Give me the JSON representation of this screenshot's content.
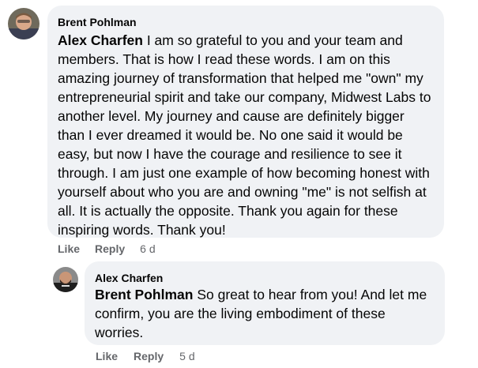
{
  "comments": [
    {
      "author": "Brent Pohlman",
      "mention": "Alex Charfen",
      "body": " I am so grateful to you and your team and members. That is how I read these words. I am on this amazing journey of transformation that helped me \"own\" my entrepreneurial spirit and take our company, Midwest Labs to another level. My journey and cause are definitely bigger than I ever dreamed it would be. No one said it would be easy, but now I have the courage and resilience to see it through. I am just one example of how becoming honest with yourself about who you are and owning \"me\" is not selfish at all. It is actually the opposite. Thank you again for these inspiring words. Thank you!",
      "like_label": "Like",
      "reply_label": "Reply",
      "time": "6 d"
    },
    {
      "author": "Alex Charfen",
      "mention": "Brent Pohlman",
      "body": " So great to hear from you! And let me confirm, you are the living embodiment of these worries.",
      "like_label": "Like",
      "reply_label": "Reply",
      "time": "5 d"
    }
  ]
}
